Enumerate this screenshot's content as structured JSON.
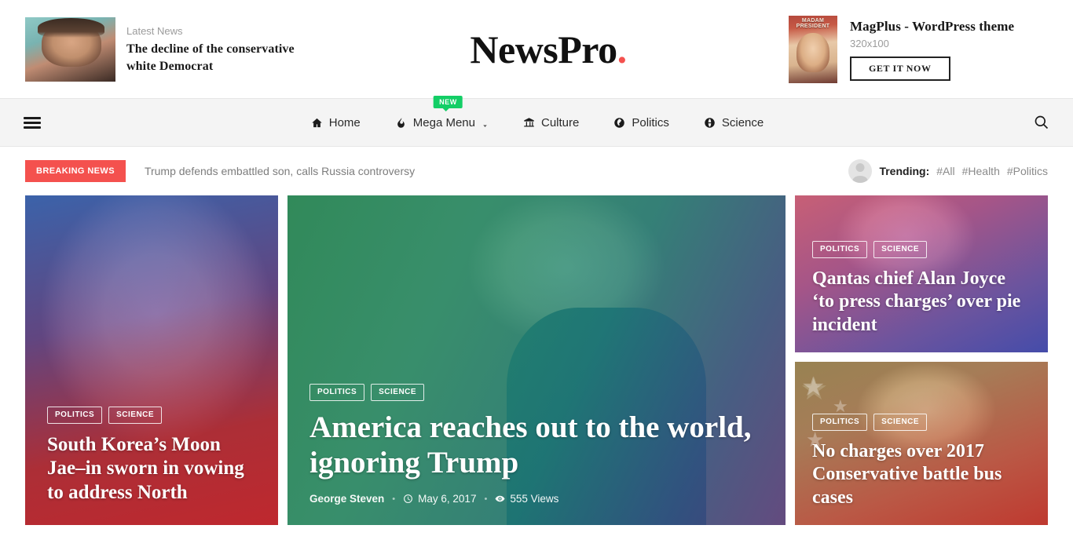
{
  "header": {
    "latest_news": {
      "label": "Latest News",
      "title": "The decline of the conservative white Democrat",
      "thumb_icon": "portrait-thumbnail"
    },
    "logo": {
      "text": "NewsPro",
      "dot": ".",
      "accent_color": "#f4514e"
    },
    "ad": {
      "cover_title": "MADAM PRESIDENT",
      "title": "MagPlus - WordPress theme",
      "size": "320x100",
      "button": "GET IT NOW"
    }
  },
  "nav": {
    "menu_icon": "hamburger-icon",
    "search_icon": "search-icon",
    "items": [
      {
        "label": "Home",
        "icon": "home-icon",
        "badge": null,
        "chevron": false
      },
      {
        "label": "Mega Menu",
        "icon": "fire-icon",
        "badge": "NEW",
        "chevron": true
      },
      {
        "label": "Culture",
        "icon": "museum-icon",
        "badge": null,
        "chevron": false
      },
      {
        "label": "Politics",
        "icon": "globe-icon",
        "badge": null,
        "chevron": false
      },
      {
        "label": "Science",
        "icon": "network-globe-icon",
        "badge": null,
        "chevron": false
      }
    ],
    "badge_color": "#13ce66"
  },
  "breaking": {
    "badge": "BREAKING NEWS",
    "badge_color": "#f4514e",
    "text": "Trump defends embattled son, calls Russia controversy",
    "trending": {
      "avatar": "user-avatar",
      "label": "Trending:",
      "tags": [
        "#All",
        "#Health",
        "#Politics"
      ]
    }
  },
  "features": {
    "left": {
      "categories": [
        "POLITICS",
        "SCIENCE"
      ],
      "title": "South Korea’s Moon Jae–in sworn in vowing to address North"
    },
    "main": {
      "categories": [
        "POLITICS",
        "SCIENCE"
      ],
      "title": "America reaches out to the world, ignoring Trump",
      "author": "George Steven",
      "date": "May 6, 2017",
      "views": "555 Views",
      "date_icon": "clock-icon",
      "views_icon": "eye-icon"
    },
    "right_top": {
      "categories": [
        "POLITICS",
        "SCIENCE"
      ],
      "title": "Qantas chief Alan Joyce ‘to press charges’ over pie incident"
    },
    "right_bottom": {
      "categories": [
        "POLITICS",
        "SCIENCE"
      ],
      "title": "No charges over 2017 Conservative battle bus cases"
    }
  }
}
